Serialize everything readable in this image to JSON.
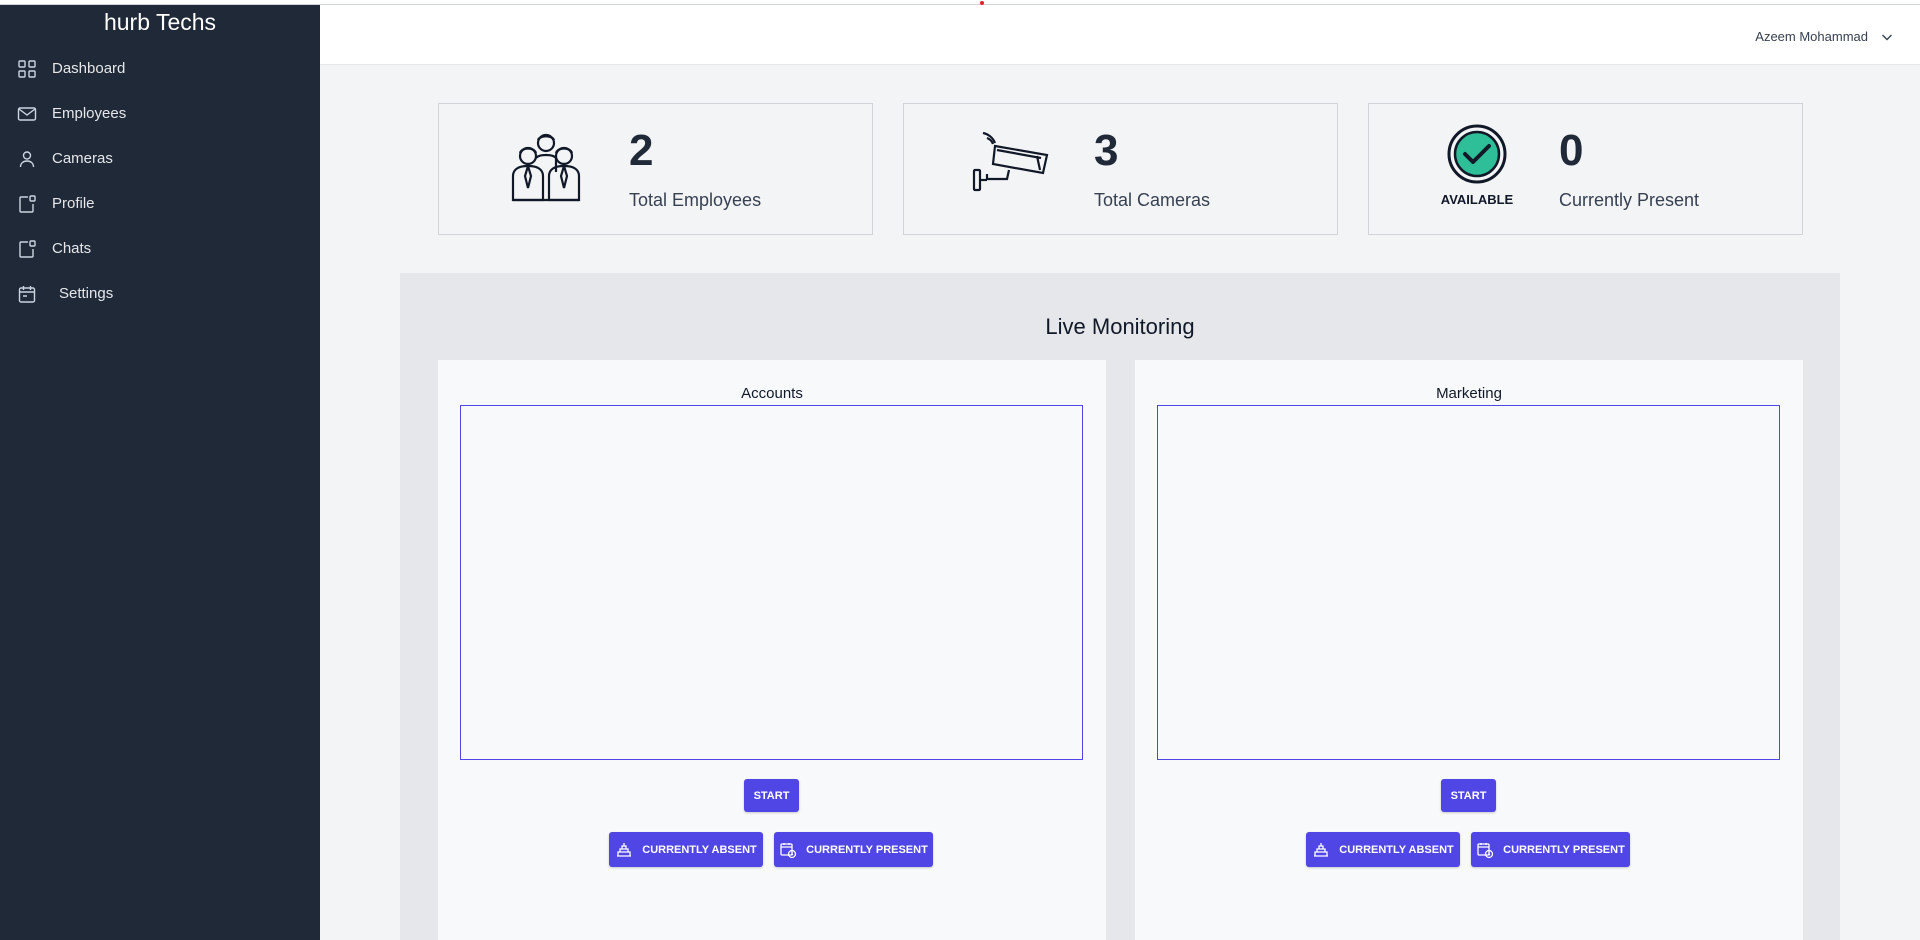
{
  "brand": "hurb Techs",
  "sidebar": {
    "items": [
      {
        "label": "Dashboard",
        "icon": "grid-icon"
      },
      {
        "label": "Employees",
        "icon": "mail-icon"
      },
      {
        "label": "Cameras",
        "icon": "user-icon"
      },
      {
        "label": "Profile",
        "icon": "tag-icon"
      },
      {
        "label": "Chats",
        "icon": "tag-icon"
      },
      {
        "label": "Settings",
        "icon": "calendar-icon"
      }
    ]
  },
  "header": {
    "user_name": "Azeem Mohammad"
  },
  "stats": [
    {
      "value": "2",
      "label": "Total Employees",
      "icon": "employees-group-icon"
    },
    {
      "value": "3",
      "label": "Total Cameras",
      "icon": "security-camera-icon"
    },
    {
      "value": "0",
      "label": "Currently Present",
      "icon": "available-check-icon",
      "badge": "AVAILABLE"
    }
  ],
  "monitor": {
    "title": "Live Monitoring",
    "panels": [
      {
        "title": "Accounts",
        "start_label": "START",
        "absent_label": "CURRENTLY ABSENT",
        "present_label": "CURRENTLY PRESENT"
      },
      {
        "title": "Marketing",
        "start_label": "START",
        "absent_label": "CURRENTLY ABSENT",
        "present_label": "CURRENTLY PRESENT"
      }
    ]
  },
  "colors": {
    "sidebar_bg": "#1f2937",
    "accent": "#4f46e5",
    "available_green": "#10b981"
  }
}
